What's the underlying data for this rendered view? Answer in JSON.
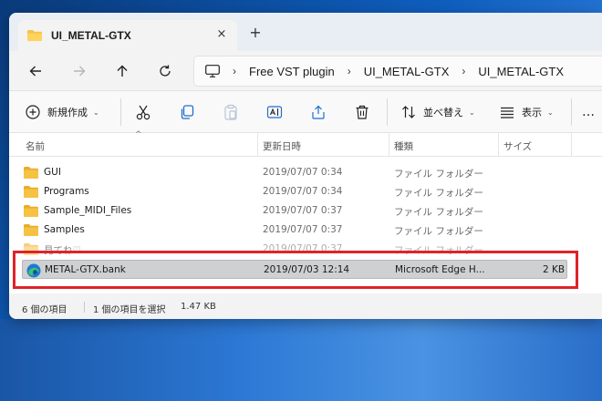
{
  "window": {
    "tab_title": "UI_METAL-GTX",
    "tab_close": "×",
    "tab_add": "+"
  },
  "nav": {
    "breadcrumbs": [
      "Free VST plugin",
      "UI_METAL-GTX",
      "UI_METAL-GTX"
    ],
    "separator": "›"
  },
  "toolbar": {
    "new_label": "新規作成",
    "sort_label": "並べ替え",
    "view_label": "表示",
    "caret": "⌄",
    "more": "…"
  },
  "columns": {
    "name": "名前",
    "date": "更新日時",
    "type": "種類",
    "size": "サイズ",
    "sort_indicator": "^"
  },
  "files": [
    {
      "name": "GUI",
      "date": "2019/07/07 0:34",
      "type": "ファイル フォルダー",
      "size": "",
      "icon": "folder-icon"
    },
    {
      "name": "Programs",
      "date": "2019/07/07 0:34",
      "type": "ファイル フォルダー",
      "size": "",
      "icon": "folder-icon"
    },
    {
      "name": "Sample_MIDI_Files",
      "date": "2019/07/07 0:37",
      "type": "ファイル フォルダー",
      "size": "",
      "icon": "folder-icon"
    },
    {
      "name": "Samples",
      "date": "2019/07/07 0:37",
      "type": "ファイル フォルダー",
      "size": "",
      "icon": "folder-icon"
    },
    {
      "name": "見てね♡",
      "date": "2019/07/07 0:37",
      "type": "ファイル フォルダー",
      "size": "",
      "icon": "folder-icon"
    },
    {
      "name": "METAL-GTX.bank",
      "date": "2019/07/03 12:14",
      "type": "Microsoft Edge H...",
      "size": "2 KB",
      "icon": "edge-icon"
    }
  ],
  "status": {
    "item_count": "6 個の項目",
    "selected": "1 個の項目を選択",
    "selected_size": "1.47 KB"
  },
  "colors": {
    "highlight": "#e0222a",
    "folder": "#f6c244",
    "edge_blue": "#1c7ad6",
    "edge_green": "#3ec46d"
  }
}
